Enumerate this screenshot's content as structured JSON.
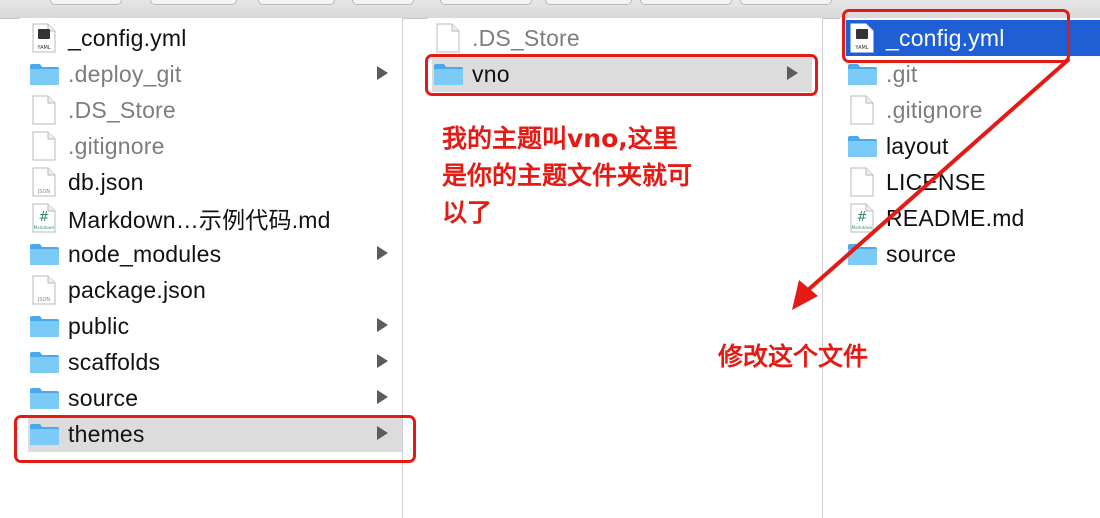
{
  "columns": {
    "col1": [
      {
        "name": "_config.yml",
        "icon": "yaml-file-icon",
        "dim": false,
        "folder_arrow": false
      },
      {
        "name": ".deploy_git",
        "icon": "folder-icon",
        "dim": true,
        "folder_arrow": true
      },
      {
        "name": ".DS_Store",
        "icon": "blank-file-icon",
        "dim": true,
        "folder_arrow": false
      },
      {
        "name": ".gitignore",
        "icon": "blank-file-icon",
        "dim": true,
        "folder_arrow": false
      },
      {
        "name": "db.json",
        "icon": "json-file-icon",
        "dim": false,
        "folder_arrow": false
      },
      {
        "name": "Markdown…示例代码.md",
        "icon": "markdown-file-icon",
        "dim": false,
        "folder_arrow": false
      },
      {
        "name": "node_modules",
        "icon": "folder-icon",
        "dim": false,
        "folder_arrow": true
      },
      {
        "name": "package.json",
        "icon": "json-file-icon",
        "dim": false,
        "folder_arrow": false
      },
      {
        "name": "public",
        "icon": "folder-icon",
        "dim": false,
        "folder_arrow": true
      },
      {
        "name": "scaffolds",
        "icon": "folder-icon",
        "dim": false,
        "folder_arrow": true
      },
      {
        "name": "source",
        "icon": "folder-icon",
        "dim": false,
        "folder_arrow": true
      },
      {
        "name": "themes",
        "icon": "folder-icon",
        "dim": false,
        "folder_arrow": true,
        "selected": true
      }
    ],
    "col2": [
      {
        "name": ".DS_Store",
        "icon": "blank-file-icon",
        "dim": true,
        "folder_arrow": false
      },
      {
        "name": "vno",
        "icon": "folder-icon",
        "dim": false,
        "folder_arrow": true,
        "selected": true
      }
    ],
    "col3": [
      {
        "name": "_config.yml",
        "icon": "yaml-file-icon",
        "dim": false,
        "folder_arrow": false,
        "selected": true
      },
      {
        "name": ".git",
        "icon": "folder-icon",
        "dim": true,
        "folder_arrow": false
      },
      {
        "name": ".gitignore",
        "icon": "blank-file-icon",
        "dim": true,
        "folder_arrow": false
      },
      {
        "name": "layout",
        "icon": "folder-icon",
        "dim": false,
        "folder_arrow": false
      },
      {
        "name": "LICENSE",
        "icon": "blank-file-icon",
        "dim": false,
        "folder_arrow": false
      },
      {
        "name": "README.md",
        "icon": "markdown-file-icon",
        "dim": false,
        "folder_arrow": false
      },
      {
        "name": "source",
        "icon": "folder-icon",
        "dim": false,
        "folder_arrow": false
      }
    ]
  },
  "icon_labels": {
    "yaml": "YAML",
    "json": "JSON",
    "markdown": "Markdown",
    "hash": "#"
  },
  "annotations": {
    "theme_note": [
      "我的主题叫vno,这里",
      "是你的主题文件夹就可",
      "以了"
    ],
    "modify_note": "修改这个文件"
  },
  "colors": {
    "annotation_red": "#e41b14",
    "selection_blue": "#1f5fd6",
    "selection_gray": "#dcdcdc",
    "folder_blue": "#5bb8f5"
  }
}
